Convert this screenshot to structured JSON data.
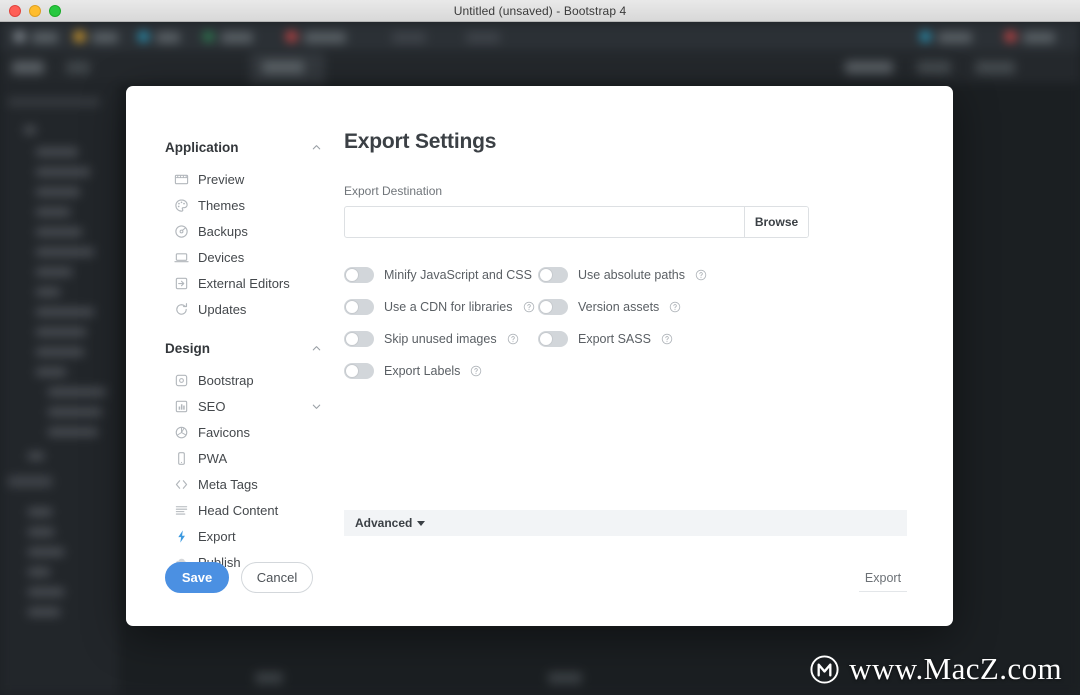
{
  "window": {
    "title": "Untitled (unsaved) - Bootstrap 4",
    "traffic_lights": [
      "close",
      "minimize",
      "maximize"
    ]
  },
  "modal": {
    "title": "Export Settings",
    "nav": {
      "groups": [
        {
          "title": "Application",
          "chevron": "chevron-up-icon",
          "items": [
            {
              "label": "Preview",
              "icon": "film-icon"
            },
            {
              "label": "Themes",
              "icon": "palette-icon"
            },
            {
              "label": "Backups",
              "icon": "disc-icon"
            },
            {
              "label": "Devices",
              "icon": "laptop-icon"
            },
            {
              "label": "External Editors",
              "icon": "external-editor-icon"
            },
            {
              "label": "Updates",
              "icon": "refresh-icon"
            }
          ]
        },
        {
          "title": "Design",
          "chevron": "chevron-up-icon",
          "items": [
            {
              "label": "Bootstrap",
              "icon": "bootstrap-icon"
            },
            {
              "label": "SEO",
              "icon": "bar-chart-icon",
              "chevron": "chevron-down-icon"
            },
            {
              "label": "Favicons",
              "icon": "favicon-icon"
            },
            {
              "label": "PWA",
              "icon": "phone-icon"
            },
            {
              "label": "Meta Tags",
              "icon": "code-brackets-icon"
            },
            {
              "label": "Head Content",
              "icon": "lines-icon"
            },
            {
              "label": "Export",
              "icon": "bolt-icon",
              "active": true
            },
            {
              "label": "Publish",
              "icon": "cloud-icon"
            }
          ]
        }
      ]
    },
    "buttons": {
      "save": "Save",
      "cancel": "Cancel"
    },
    "destination": {
      "label": "Export Destination",
      "value": "",
      "placeholder": "",
      "browse": "Browse"
    },
    "toggles": [
      {
        "label": "Minify JavaScript and CSS",
        "on": false,
        "help": false
      },
      {
        "label": "Use absolute paths",
        "on": false,
        "help": true
      },
      {
        "label": "Use a CDN for libraries",
        "on": false,
        "help": true
      },
      {
        "label": "Version assets",
        "on": false,
        "help": true
      },
      {
        "label": "Skip unused images",
        "on": false,
        "help": true
      },
      {
        "label": "Export SASS",
        "on": false,
        "help": true
      },
      {
        "label": "Export Labels",
        "on": false,
        "help": true
      }
    ],
    "advanced": {
      "label": "Advanced",
      "icon": "caret-down-icon",
      "expanded": false
    },
    "export_action": "Export"
  },
  "watermark": {
    "text": "www.MacZ.com",
    "logo": "circled-m-logo"
  },
  "colors": {
    "accent_blue": "#4b90e2",
    "bolt_blue": "#3d9ae0",
    "toggle_off": "#d2d6da",
    "advanced_bar": "#f2f4f6",
    "modal_bg": "#ffffff",
    "titlebar": "#e4e4e4",
    "backdrop": "#202427"
  }
}
